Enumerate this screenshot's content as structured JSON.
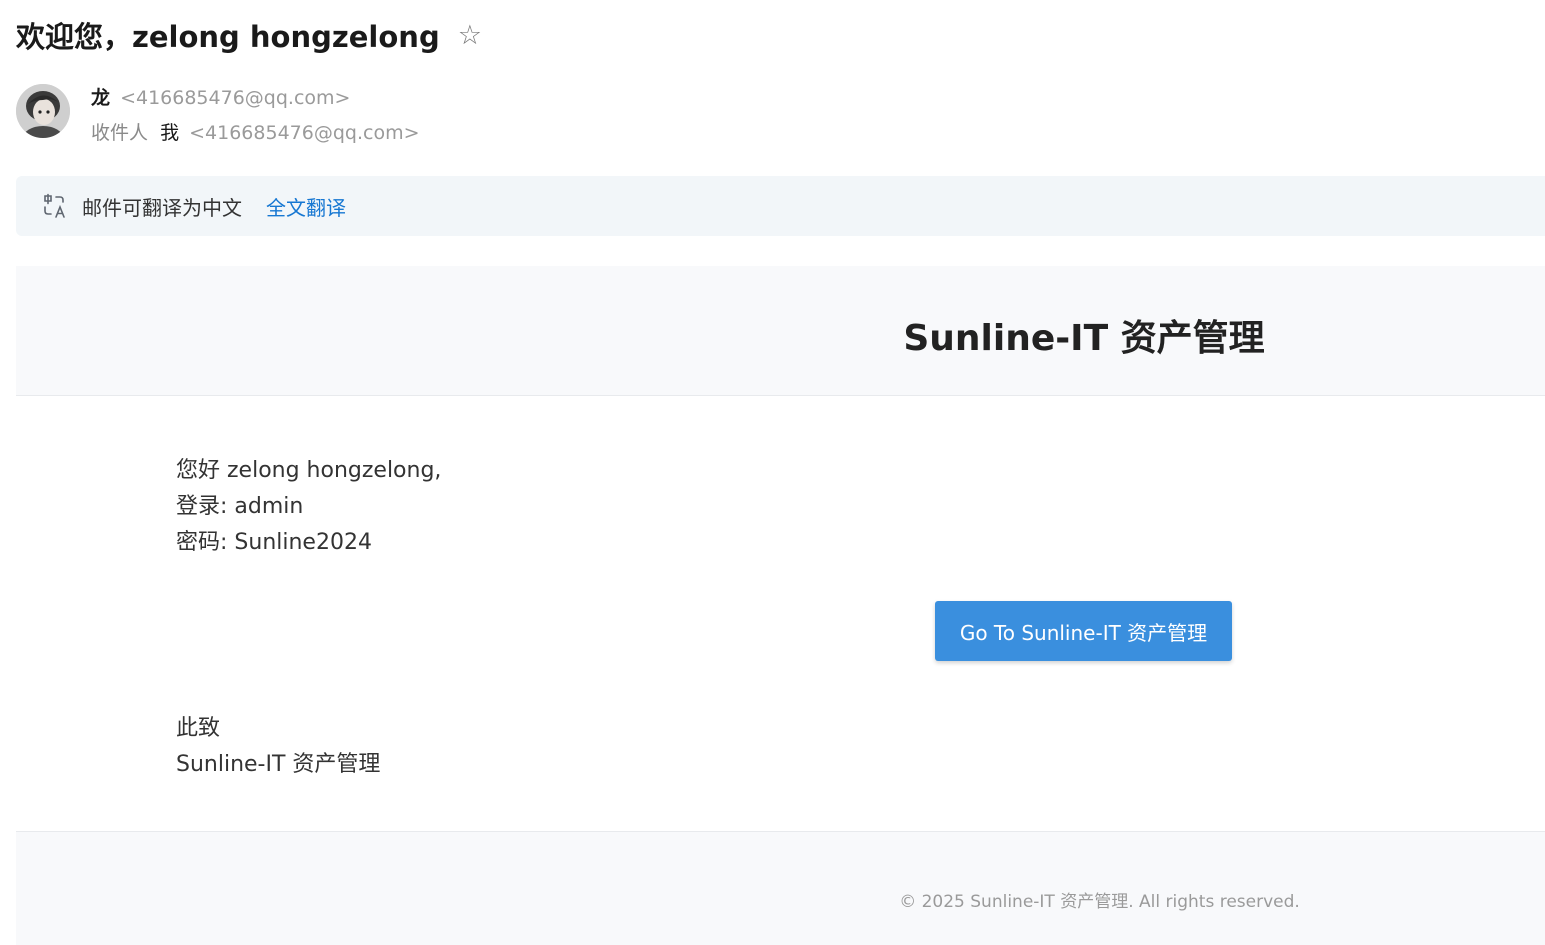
{
  "subject": {
    "title": "欢迎您，zelong hongzelong",
    "star_icon": "star-outline-icon"
  },
  "sender": {
    "name": "龙",
    "email": "<416685476@qq.com>",
    "avatar_icon": "avatar-photo"
  },
  "recipient": {
    "label": "收件人",
    "name": "我",
    "email": "<416685476@qq.com>"
  },
  "translate_bar": {
    "icon": "translate-icon",
    "message": "邮件可翻译为中文",
    "action": "全文翻译"
  },
  "email": {
    "header_title": "Sunline-IT 资产管理",
    "greeting": "您好 zelong hongzelong,",
    "login_line": "登录: admin",
    "password_line": "密码: Sunline2024",
    "button_label": "Go To Sunline-IT 资产管理",
    "signoff": "此致",
    "signature": "Sunline-IT 资产管理",
    "footer": "© 2025 Sunline-IT 资产管理. All rights reserved."
  },
  "colors": {
    "link": "#1677d2",
    "button": "#3a8fde",
    "translate_bar_bg": "#f2f6f9",
    "email_section_bg": "#f8f9fb"
  }
}
